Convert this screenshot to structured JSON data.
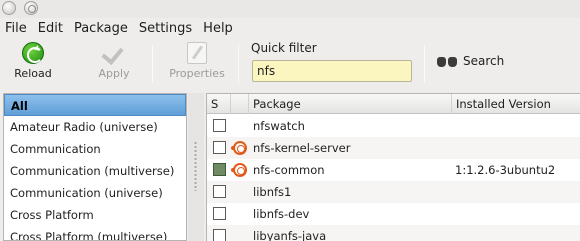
{
  "menubar": {
    "items": [
      "File",
      "Edit",
      "Package",
      "Settings",
      "Help"
    ]
  },
  "toolbar": {
    "reload_label": "Reload",
    "apply_label": "Apply",
    "properties_label": "Properties",
    "quick_filter_label": "Quick filter",
    "quick_filter_value": "nfs",
    "search_label": "Search"
  },
  "icons": {
    "reload": "reload-icon",
    "apply": "checkmark-icon",
    "properties": "properties-icon",
    "search": "binoculars-icon",
    "ubuntu": "ubuntu-logo-icon"
  },
  "sections": {
    "items": [
      {
        "label": "All",
        "selected": true
      },
      {
        "label": "Amateur Radio (universe)",
        "selected": false
      },
      {
        "label": "Communication",
        "selected": false
      },
      {
        "label": "Communication (multiverse)",
        "selected": false
      },
      {
        "label": "Communication (universe)",
        "selected": false
      },
      {
        "label": "Cross Platform",
        "selected": false
      },
      {
        "label": "Cross Platform (multiverse)",
        "selected": false
      }
    ]
  },
  "packages": {
    "columns": {
      "status": "S",
      "package": "Package",
      "version": "Installed Version"
    },
    "rows": [
      {
        "name": "nfswatch",
        "installed_version": "",
        "installed": false,
        "supported": false
      },
      {
        "name": "nfs-kernel-server",
        "installed_version": "",
        "installed": false,
        "supported": true
      },
      {
        "name": "nfs-common",
        "installed_version": "1:1.2.6-3ubuntu2",
        "installed": true,
        "supported": true
      },
      {
        "name": "libnfs1",
        "installed_version": "",
        "installed": false,
        "supported": false
      },
      {
        "name": "libnfs-dev",
        "installed_version": "",
        "installed": false,
        "supported": false
      },
      {
        "name": "libyanfs-java",
        "installed_version": "",
        "installed": false,
        "supported": false
      }
    ]
  },
  "colors": {
    "filter_background": "#fbf6c0",
    "selection": "#5f9fd8",
    "installed_checkbox": "#6e8b62",
    "ubuntu_orange": "#e05b1c"
  }
}
